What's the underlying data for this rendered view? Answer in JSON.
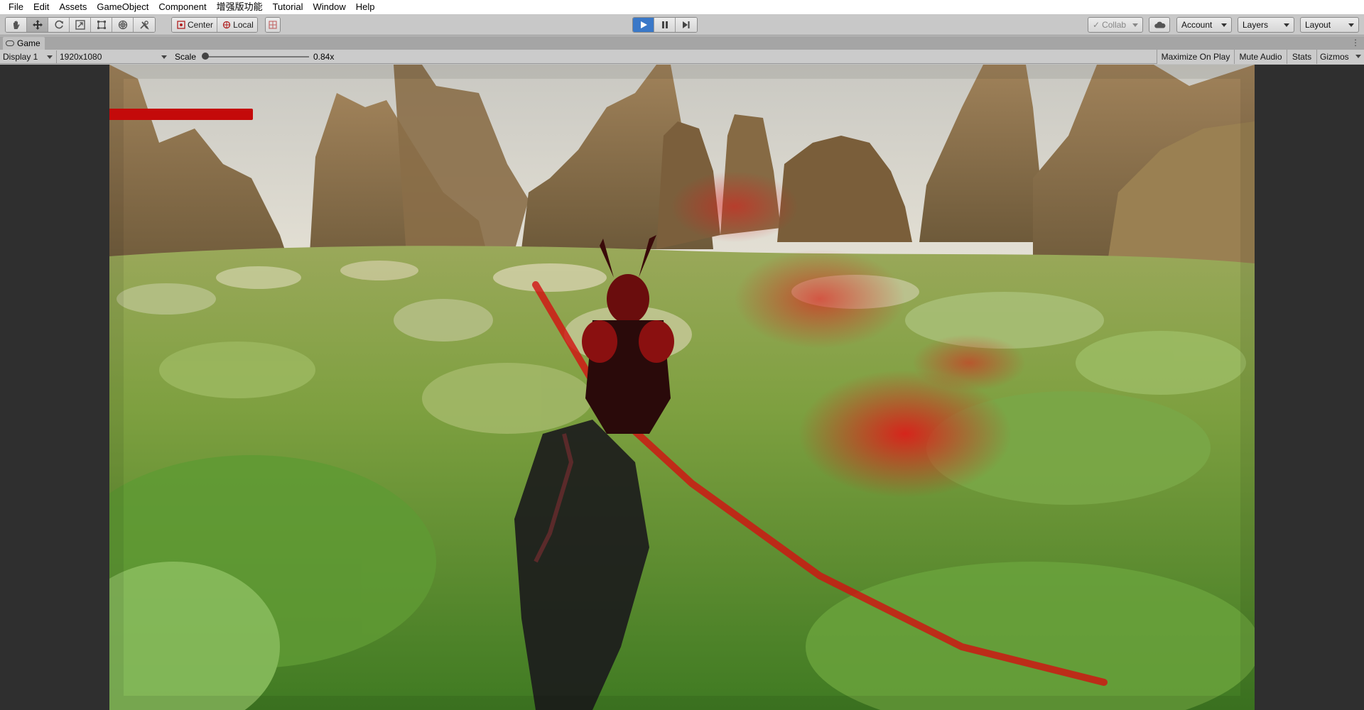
{
  "menu": [
    "File",
    "Edit",
    "Assets",
    "GameObject",
    "Component",
    "增强版功能",
    "Tutorial",
    "Window",
    "Help"
  ],
  "toolbar": {
    "tools": [
      {
        "name": "hand-tool-button",
        "icon": "hand-icon"
      },
      {
        "name": "move-tool-button",
        "icon": "move-icon"
      },
      {
        "name": "rotate-tool-button",
        "icon": "rotate-icon"
      },
      {
        "name": "scale-tool-button",
        "icon": "scale-icon"
      },
      {
        "name": "rect-tool-button",
        "icon": "rect-icon"
      },
      {
        "name": "transform-tool-button",
        "icon": "transform-icon"
      },
      {
        "name": "custom-tool-button",
        "icon": "tools-icon"
      }
    ],
    "pivot_label": "Center",
    "space_label": "Local",
    "collab_label": "Collab",
    "account_label": "Account",
    "layers_label": "Layers",
    "layout_label": "Layout",
    "play_active_color": "#3a78c8"
  },
  "game_tab": {
    "label": "Game"
  },
  "game_controls": {
    "display": "Display 1",
    "resolution": "1920x1080",
    "scale_label": "Scale",
    "scale_value": "0.84x",
    "maximize_on_play": "Maximize On Play",
    "mute_audio": "Mute Audio",
    "stats": "Stats",
    "gizmos": "Gizmos"
  },
  "game_view": {
    "player_health_fraction": 1.0,
    "health_color": "#c40a0a"
  }
}
